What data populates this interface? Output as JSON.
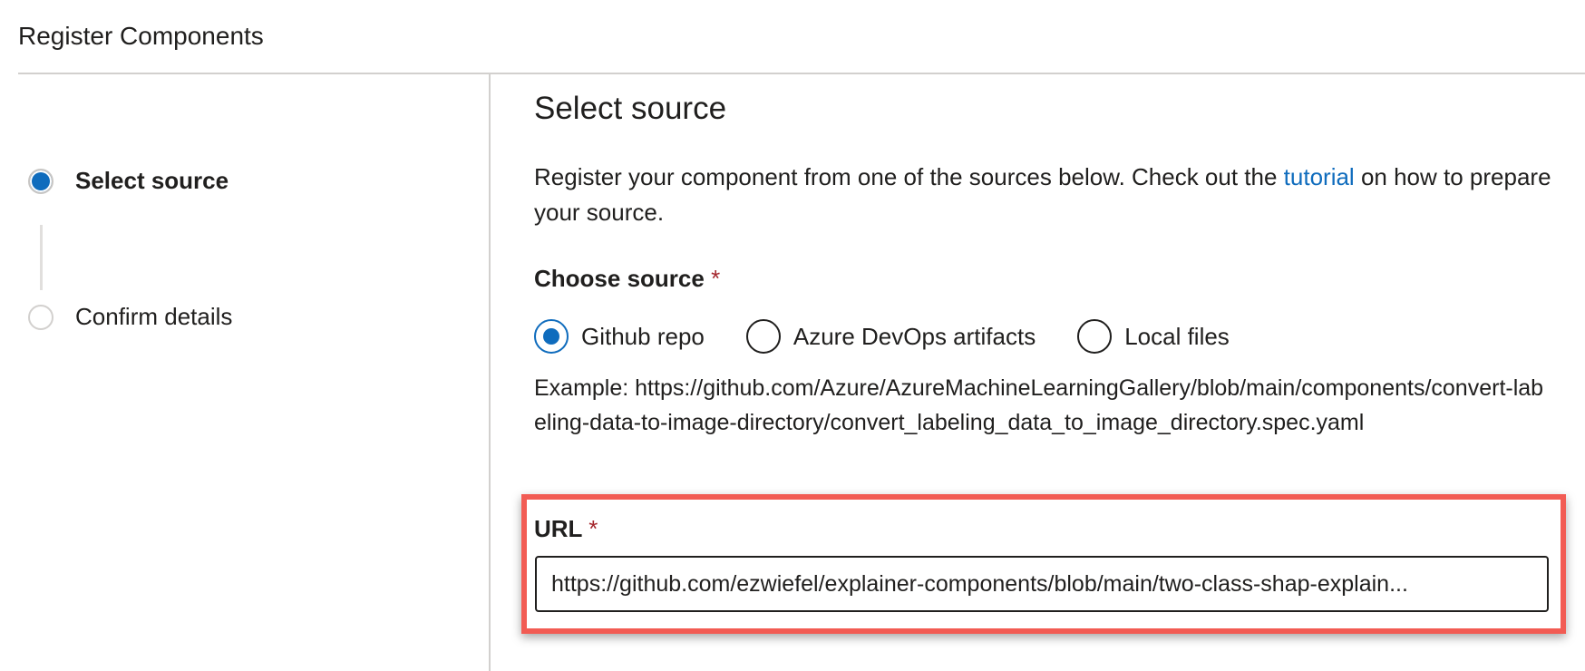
{
  "header": {
    "title": "Register Components"
  },
  "steps": [
    {
      "label": "Select source",
      "state": "active"
    },
    {
      "label": "Confirm details",
      "state": "inactive"
    }
  ],
  "main": {
    "title": "Select source",
    "description_prefix": "Register your component from one of the sources below. Check out the ",
    "description_link": "tutorial",
    "description_suffix": " on how to prepare your source.",
    "choose_source_label": "Choose source",
    "required_marker": "*",
    "source_options": [
      {
        "label": "Github repo",
        "checked": true
      },
      {
        "label": "Azure DevOps artifacts",
        "checked": false
      },
      {
        "label": "Local files",
        "checked": false
      }
    ],
    "example_text": "Example: https://github.com/Azure/AzureMachineLearningGallery/blob/main/components/convert-labeling-data-to-image-directory/convert_labeling_data_to_image_directory.spec.yaml",
    "url_label": "URL",
    "url_value": "https://github.com/ezwiefel/explainer-components/blob/main/two-class-shap-explain..."
  },
  "colors": {
    "accent": "#0f6cbd",
    "required": "#a4262c",
    "highlight": "#f25c54"
  }
}
